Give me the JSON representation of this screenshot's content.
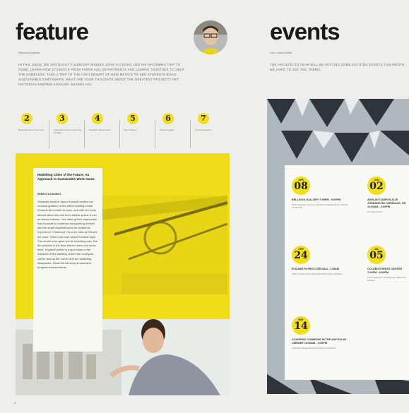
{
  "feature": {
    "heading": "feature",
    "byline": "Rebecca Daniels",
    "intro": "In this issue, we spotlight Fulbright winner John Yi Chong and his upcoming trip to Rome. Learn how students from three ASU departments are coming together to help the homeless. Take a trip to the high desert of New Mexico to see students build sustainable earthships. What are your thoughts about the greatest project? Art historian Andrew Koniuski shares his.",
    "numbers": [
      {
        "num": "2",
        "caption": "Breaking down at the heart"
      },
      {
        "num": "3",
        "caption": "Latest about art coming to the hospital"
      },
      {
        "num": "4",
        "caption": "Spotlight: Wheels hold"
      },
      {
        "num": "5",
        "caption": "Book Review"
      },
      {
        "num": "6",
        "caption": "Design Insights"
      },
      {
        "num": "7",
        "caption": "Upcoming Events"
      }
    ],
    "article": {
      "title": "Modelling Cities of the Future: An Approach to Sustainable Work Game",
      "author": "REBECCA DANIELS",
      "body": "Graduate student Jason Kroskoff studies the unusual gradient of the office building model. Kroskoff likes what his tools, and with her tools almost failed hair and even darker space, it can an almost intense. You often get the impression that Kroskoff is somehow transporting himself into the small modeled world he created to experience it firsthand. He even talks as if that's the case: 'When you have upset Kroskoff says. The model once gave you at a weekly pace. But the problem is the floor strives down one much here.' Kroskoff points to a spot close to the entrance of the building, where the courtyard corner around the corner and the waterway disappears. Read the full story at www.arts-program.edu/architects"
    }
  },
  "events": {
    "heading": "events",
    "byline": "Sue Lucas Stratis",
    "intro": "The architects team will be hosting some exciting events this month. We hope to see you there!",
    "items": [
      {
        "month": "APR",
        "day": "08",
        "title": "Bellison Gallery 7:00PM - 9:00PM",
        "detail": "Peter Pedersen discusses Environmental Ideology of Public Landmarks"
      },
      {
        "month": "JUN",
        "day": "02",
        "title": "Ashlar Campus 2125 Jordans Rd Farsdale, OR 11:00AM - 3:00PM",
        "detail": "Art major shows"
      },
      {
        "month": "APR",
        "day": "24",
        "title": "Elizabeth Proctor Hall 7:30AM",
        "detail": "Clarion Guild to Succeed Class 2007 Call for students"
      },
      {
        "month": "JUL",
        "day": "05",
        "title": "Colden Events Center 7:00PM - 9:00PM",
        "detail": "Future Direction of Design Eco 2012 Arts Festival"
      },
      {
        "month": "MAY",
        "day": "14",
        "title": "Academic Commons in the Macaulay Library 10:00AM - 3:00PM",
        "detail": "Collective Design Workshop Teams of students"
      }
    ]
  },
  "page_number": "4"
}
